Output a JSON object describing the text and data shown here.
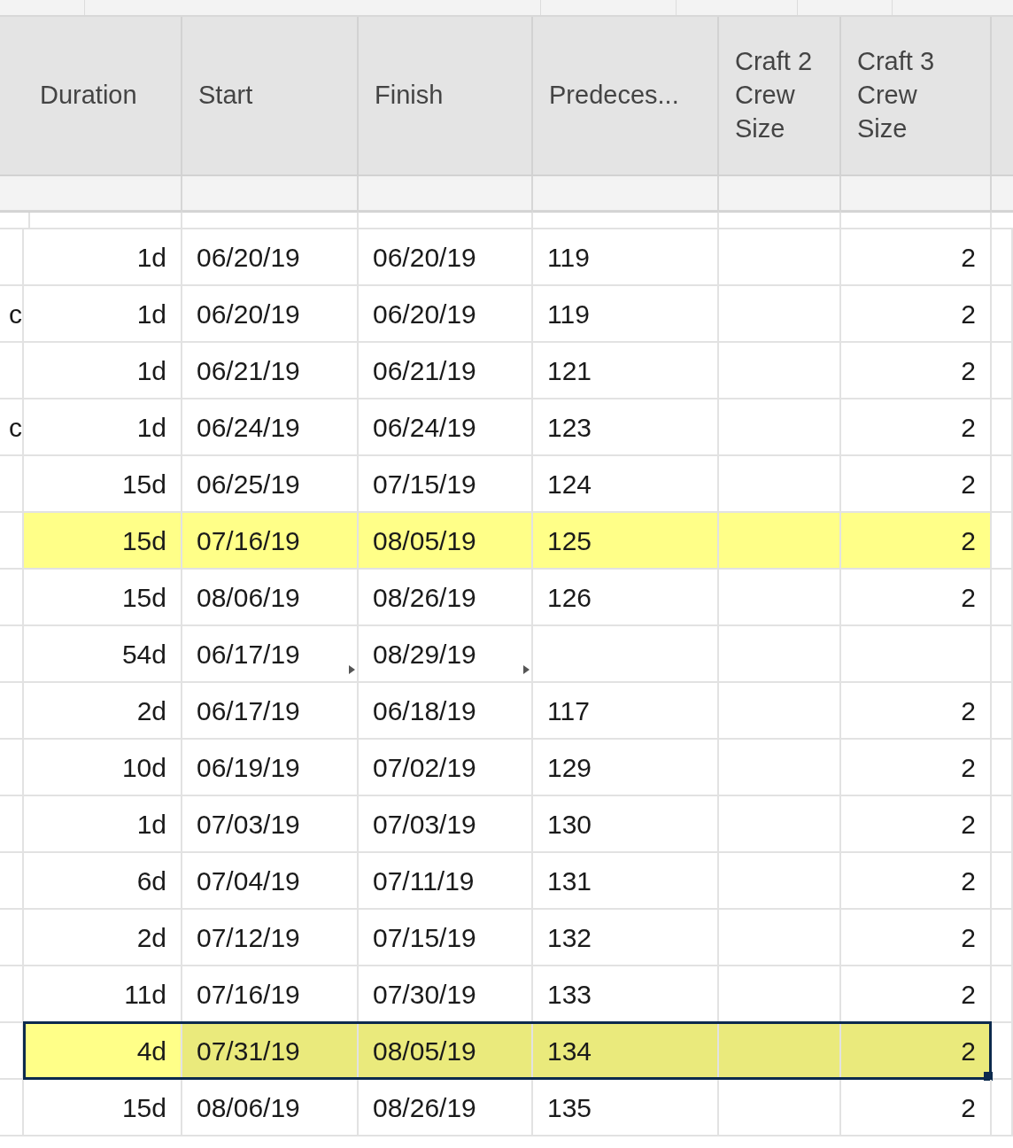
{
  "columns": [
    {
      "label": "Duration"
    },
    {
      "label": "Start"
    },
    {
      "label": "Finish"
    },
    {
      "label": "Predeces..."
    },
    {
      "label": "Craft 2 Crew Size"
    },
    {
      "label": "Craft 3 Crew Size"
    }
  ],
  "rows": [
    {
      "column_1": "",
      "duration": "1d",
      "start": "06/20/19",
      "finish": "06/20/19",
      "predecessors": "119",
      "craft_2": "",
      "craft_3": "2",
      "highlighted": false,
      "selected": false,
      "summary": false
    },
    {
      "column_1": "c",
      "duration": "1d",
      "start": "06/20/19",
      "finish": "06/20/19",
      "predecessors": "119",
      "craft_2": "",
      "craft_3": "2",
      "highlighted": false,
      "selected": false,
      "summary": false
    },
    {
      "column_1": "",
      "duration": "1d",
      "start": "06/21/19",
      "finish": "06/21/19",
      "predecessors": "121",
      "craft_2": "",
      "craft_3": "2",
      "highlighted": false,
      "selected": false,
      "summary": false
    },
    {
      "column_1": "c",
      "duration": "1d",
      "start": "06/24/19",
      "finish": "06/24/19",
      "predecessors": "123",
      "craft_2": "",
      "craft_3": "2",
      "highlighted": false,
      "selected": false,
      "summary": false
    },
    {
      "column_1": "",
      "duration": "15d",
      "start": "06/25/19",
      "finish": "07/15/19",
      "predecessors": "124",
      "craft_2": "",
      "craft_3": "2",
      "highlighted": false,
      "selected": false,
      "summary": false
    },
    {
      "column_1": "",
      "duration": "15d",
      "start": "07/16/19",
      "finish": "08/05/19",
      "predecessors": "125",
      "craft_2": "",
      "craft_3": "2",
      "highlighted": true,
      "selected": false,
      "summary": false
    },
    {
      "column_1": "",
      "duration": "15d",
      "start": "08/06/19",
      "finish": "08/26/19",
      "predecessors": "126",
      "craft_2": "",
      "craft_3": "2",
      "highlighted": false,
      "selected": false,
      "summary": false
    },
    {
      "column_1": "",
      "duration": "54d",
      "start": "06/17/19",
      "finish": "08/29/19",
      "predecessors": "",
      "craft_2": "",
      "craft_3": "",
      "highlighted": false,
      "selected": false,
      "summary": true
    },
    {
      "column_1": "",
      "duration": "2d",
      "start": "06/17/19",
      "finish": "06/18/19",
      "predecessors": "117",
      "craft_2": "",
      "craft_3": "2",
      "highlighted": false,
      "selected": false,
      "summary": false
    },
    {
      "column_1": "",
      "duration": "10d",
      "start": "06/19/19",
      "finish": "07/02/19",
      "predecessors": "129",
      "craft_2": "",
      "craft_3": "2",
      "highlighted": false,
      "selected": false,
      "summary": false
    },
    {
      "column_1": "",
      "duration": "1d",
      "start": "07/03/19",
      "finish": "07/03/19",
      "predecessors": "130",
      "craft_2": "",
      "craft_3": "2",
      "highlighted": false,
      "selected": false,
      "summary": false
    },
    {
      "column_1": "",
      "duration": "6d",
      "start": "07/04/19",
      "finish": "07/11/19",
      "predecessors": "131",
      "craft_2": "",
      "craft_3": "2",
      "highlighted": false,
      "selected": false,
      "summary": false
    },
    {
      "column_1": "",
      "duration": "2d",
      "start": "07/12/19",
      "finish": "07/15/19",
      "predecessors": "132",
      "craft_2": "",
      "craft_3": "2",
      "highlighted": false,
      "selected": false,
      "summary": false
    },
    {
      "column_1": "",
      "duration": "11d",
      "start": "07/16/19",
      "finish": "07/30/19",
      "predecessors": "133",
      "craft_2": "",
      "craft_3": "2",
      "highlighted": false,
      "selected": false,
      "summary": false
    },
    {
      "column_1": "",
      "duration": "4d",
      "start": "07/31/19",
      "finish": "08/05/19",
      "predecessors": "134",
      "craft_2": "",
      "craft_3": "2",
      "highlighted": true,
      "selected": true,
      "summary": false
    },
    {
      "column_1": "",
      "duration": "15d",
      "start": "08/06/19",
      "finish": "08/26/19",
      "predecessors": "135",
      "craft_2": "",
      "craft_3": "2",
      "highlighted": false,
      "selected": false,
      "summary": false
    }
  ]
}
